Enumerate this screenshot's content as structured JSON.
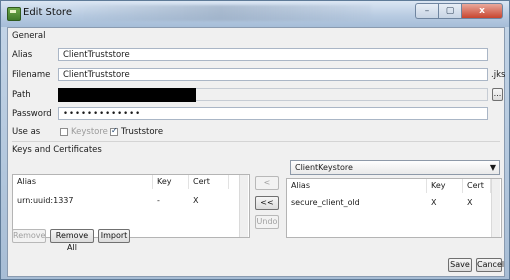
{
  "window": {
    "title": "Edit Store",
    "controls": {
      "minimize": "–",
      "maximize": "▢",
      "close": "x"
    }
  },
  "general": {
    "section": "General",
    "alias_label": "Alias",
    "alias_value": "ClientTruststore",
    "filename_label": "Filename",
    "filename_value": "ClientTruststore",
    "filename_ext": ".jks",
    "path_label": "Path",
    "browse_label": "...",
    "password_label": "Password",
    "password_value": "•••••••••••••",
    "use_as_label": "Use as",
    "keystore_label": "Keystore",
    "keystore_checked": false,
    "truststore_label": "Truststore",
    "truststore_checked": true
  },
  "keys": {
    "section": "Keys and Certificates",
    "left_table": {
      "columns": [
        "Alias",
        "Key",
        "Cert"
      ],
      "rows": [
        {
          "alias": "urn:uuid:1337",
          "key": "-",
          "cert": "X"
        }
      ]
    },
    "right_combo": "ClientKeystore",
    "right_table": {
      "columns": [
        "Alias",
        "Key",
        "Cert"
      ],
      "rows": [
        {
          "alias": "secure_client_old",
          "key": "X",
          "cert": "X"
        }
      ]
    },
    "move_right_label": "<",
    "move_all_label": "<<",
    "undo_label": "Undo",
    "remove_label": "Remove",
    "remove_all_label": "Remove All",
    "import_label": "Import"
  },
  "footer": {
    "save_label": "Save",
    "cancel_label": "Cancel"
  }
}
